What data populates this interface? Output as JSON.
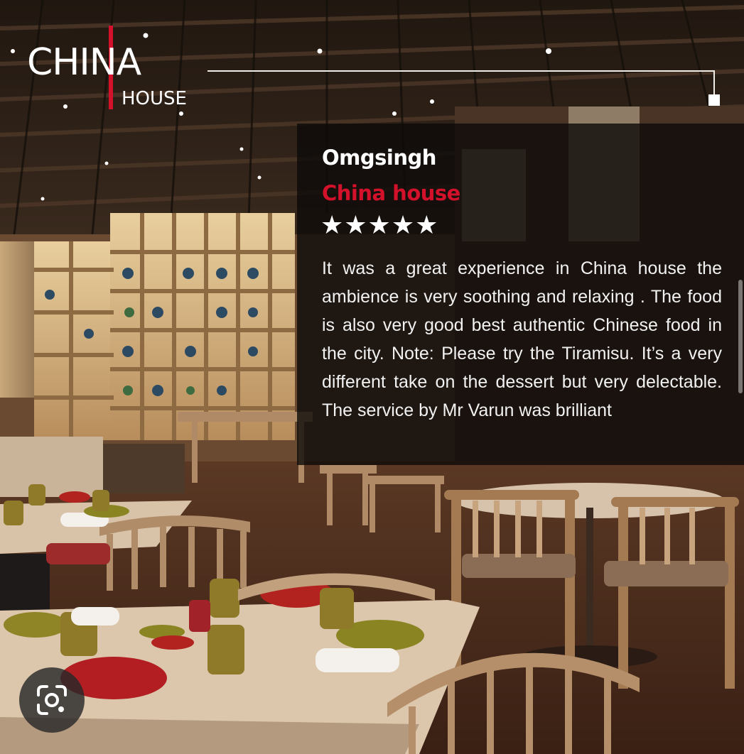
{
  "logo": {
    "word": "CHINA",
    "sub": "HOUSE"
  },
  "review": {
    "reviewer": "Omgsingh",
    "restaurant": "China house",
    "rating": 5,
    "stars": "★★★★★",
    "text": "It was a great experience in China house the ambience is very soothing and relaxing . The food is also very good best authentic Chinese food in the city. Note: Please try the Tiramisu. It’s a very different take on the dessert but very delectable. The service by Mr Varun was brilliant"
  },
  "icons": {
    "lens": "visual-search-icon"
  },
  "colors": {
    "brand_red": "#d3112a",
    "text": "#ffffff"
  }
}
